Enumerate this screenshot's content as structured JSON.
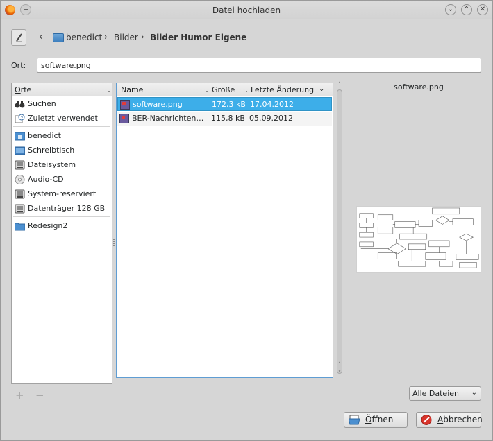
{
  "window": {
    "title": "Datei hochladen"
  },
  "breadcrumb": {
    "items": [
      "benedict",
      "Bilder",
      "Bilder Humor Eigene"
    ]
  },
  "location": {
    "label_accel": "O",
    "label_rest": "rt:",
    "value": "software.png"
  },
  "places": {
    "header_accel": "O",
    "header_rest": "rte",
    "items": [
      {
        "label": "Suchen",
        "icon": "binoculars-icon"
      },
      {
        "label": "Zuletzt verwendet",
        "icon": "recent-icon"
      },
      {
        "label": "benedict",
        "icon": "home-folder-icon"
      },
      {
        "label": "Schreibtisch",
        "icon": "desktop-icon"
      },
      {
        "label": "Dateisystem",
        "icon": "drive-icon"
      },
      {
        "label": "Audio-CD",
        "icon": "cd-icon"
      },
      {
        "label": "System-reserviert",
        "icon": "drive-icon"
      },
      {
        "label": "Datenträger 128 GB",
        "icon": "drive-icon"
      },
      {
        "label": "Redesign2",
        "icon": "folder-icon"
      }
    ]
  },
  "files": {
    "columns": [
      "Name",
      "Größe",
      "Letzte Änderung"
    ],
    "rows": [
      {
        "name": "software.png",
        "size": "172,3 kB",
        "date": "17.04.2012",
        "selected": true
      },
      {
        "name": "BER-Nachrichten.png",
        "size": "115,8 kB",
        "date": "05.09.2012",
        "selected": false
      }
    ]
  },
  "preview": {
    "filename": "software.png"
  },
  "filter": {
    "selected": "Alle Dateien"
  },
  "buttons": {
    "open_accel": "Ö",
    "open_rest": "ffnen",
    "cancel_accel": "A",
    "cancel_rest": "bbrechen"
  },
  "colors": {
    "selection": "#3daee9",
    "focus_border": "#5f9dd3",
    "cancel_icon": "#d9342b"
  }
}
